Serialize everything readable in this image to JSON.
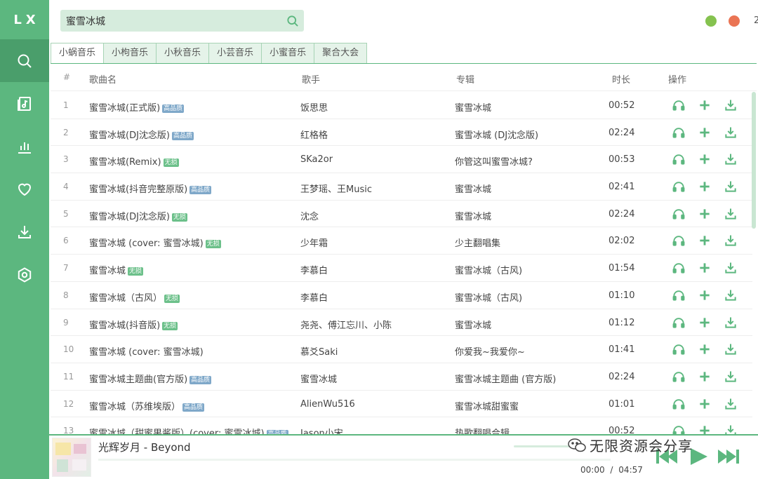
{
  "app": {
    "logo": "LX",
    "edge_char": "2"
  },
  "search": {
    "value": "蜜雪冰城"
  },
  "tabs": [
    "小蜗音乐",
    "小枸音乐",
    "小秋音乐",
    "小芸音乐",
    "小蜜音乐",
    "聚合大会"
  ],
  "active_tab": 0,
  "columns": {
    "index": "#",
    "name": "歌曲名",
    "artist": "歌手",
    "album": "专辑",
    "duration": "时长",
    "actions": "操作"
  },
  "songs": [
    {
      "index": "1",
      "name": "蜜雪冰城(正式版)",
      "badge": "高品质",
      "badge_type": "hq",
      "artist": "饭思思",
      "album": "蜜雪冰城",
      "duration": "00:52"
    },
    {
      "index": "2",
      "name": "蜜雪冰城(DJ沈念版)",
      "badge": "高品质",
      "badge_type": "hq",
      "artist": "红格格",
      "album": "蜜雪冰城 (DJ沈念版)",
      "duration": "02:24"
    },
    {
      "index": "3",
      "name": "蜜雪冰城(Remix)",
      "badge": "无损",
      "badge_type": "lossless",
      "artist": "SKa2or",
      "album": "你管这叫蜜雪冰城?",
      "duration": "00:53"
    },
    {
      "index": "4",
      "name": "蜜雪冰城(抖音完整原版)",
      "badge": "高品质",
      "badge_type": "hq",
      "artist": "王梦瑶、王Music",
      "album": "蜜雪冰城",
      "duration": "02:41"
    },
    {
      "index": "5",
      "name": "蜜雪冰城(DJ沈念版)",
      "badge": "无损",
      "badge_type": "lossless",
      "artist": "沈念",
      "album": "蜜雪冰城",
      "duration": "02:24"
    },
    {
      "index": "6",
      "name": "蜜雪冰城 (cover: 蜜雪冰城)",
      "badge": "无损",
      "badge_type": "lossless",
      "artist": "少年霜",
      "album": "少主翻唱集",
      "duration": "02:02"
    },
    {
      "index": "7",
      "name": "蜜雪冰城",
      "badge": "无损",
      "badge_type": "lossless",
      "artist": "李慕白",
      "album": "蜜雪冰城（古风)",
      "duration": "01:54"
    },
    {
      "index": "8",
      "name": "蜜雪冰城（古风）",
      "badge": "无损",
      "badge_type": "lossless",
      "artist": "李慕白",
      "album": "蜜雪冰城（古风)",
      "duration": "01:10"
    },
    {
      "index": "9",
      "name": "蜜雪冰城(抖音版)",
      "badge": "无损",
      "badge_type": "lossless",
      "artist": "尧尧、傅江忘川、小陈",
      "album": "蜜雪冰城",
      "duration": "01:12"
    },
    {
      "index": "10",
      "name": "蜜雪冰城 (cover: 蜜雪冰城)",
      "badge": "",
      "badge_type": "",
      "artist": "慕爻Saki",
      "album": "你爱我~我爱你~",
      "duration": "01:41"
    },
    {
      "index": "11",
      "name": "蜜雪冰城主题曲(官方版)",
      "badge": "高品质",
      "badge_type": "hq",
      "artist": "蜜雪冰城",
      "album": "蜜雪冰城主题曲 (官方版)",
      "duration": "02:24"
    },
    {
      "index": "12",
      "name": "蜜雪冰城（苏维埃版）",
      "badge": "高品质",
      "badge_type": "hq",
      "artist": "AlienWu516",
      "album": "蜜雪冰城甜蜜蜜",
      "duration": "01:01"
    },
    {
      "index": "13",
      "name": "蜜雪冰城（甜蜜果酱版）(cover: 蜜雪冰城)",
      "badge": "高品质",
      "badge_type": "hq",
      "artist": "Jason小宋",
      "album": "热歌翻唱合辑",
      "duration": "00:52"
    }
  ],
  "row_actions": [
    "headphones-icon",
    "plus-icon",
    "download-icon"
  ],
  "player": {
    "title": "光辉岁月 - Beyond",
    "current_time": "00:00",
    "separator": "/",
    "total_time": "04:57"
  },
  "watermark": "无限资源会分享",
  "colors": {
    "accent": "#5cb77f",
    "sidebar_active": "#4a9e6b",
    "minimize": "#85c24f",
    "close": "#ea7454",
    "badge_hq": "#7fa8c9",
    "badge_lossless": "#6cc08a"
  }
}
